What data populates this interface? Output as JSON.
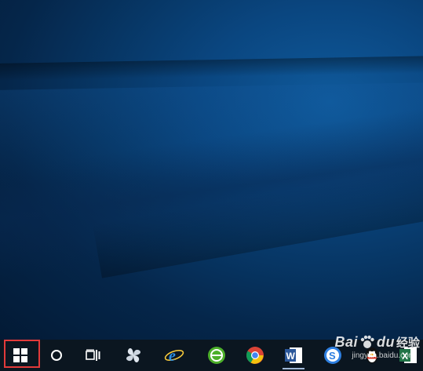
{
  "desktop": {
    "wallpaper": "windows-10-hero-blue"
  },
  "taskbar": {
    "items": [
      {
        "id": "start",
        "icon": "windows-logo-icon"
      },
      {
        "id": "cortana",
        "icon": "cortana-circle-icon"
      },
      {
        "id": "task-view",
        "icon": "task-view-icon"
      },
      {
        "id": "app-1",
        "icon": "pinwheel-app-icon"
      },
      {
        "id": "ie",
        "icon": "internet-explorer-icon"
      },
      {
        "id": "app-green",
        "icon": "green-browser-icon"
      },
      {
        "id": "chrome",
        "icon": "chrome-icon"
      },
      {
        "id": "word",
        "icon": "word-icon",
        "letter": "W"
      },
      {
        "id": "sogou",
        "icon": "sogou-icon",
        "letter": "S"
      },
      {
        "id": "qq",
        "icon": "qq-penguin-icon"
      },
      {
        "id": "excel",
        "icon": "excel-icon",
        "letter": "X"
      }
    ],
    "highlight": "start"
  },
  "watermark": {
    "brand": "Bai",
    "paw": "du",
    "cn": "经验",
    "url": "jingyan.baidu.com"
  },
  "colors": {
    "highlight": "#e23a3a",
    "taskbar": "#0b1620",
    "desktop": "#06213f"
  }
}
